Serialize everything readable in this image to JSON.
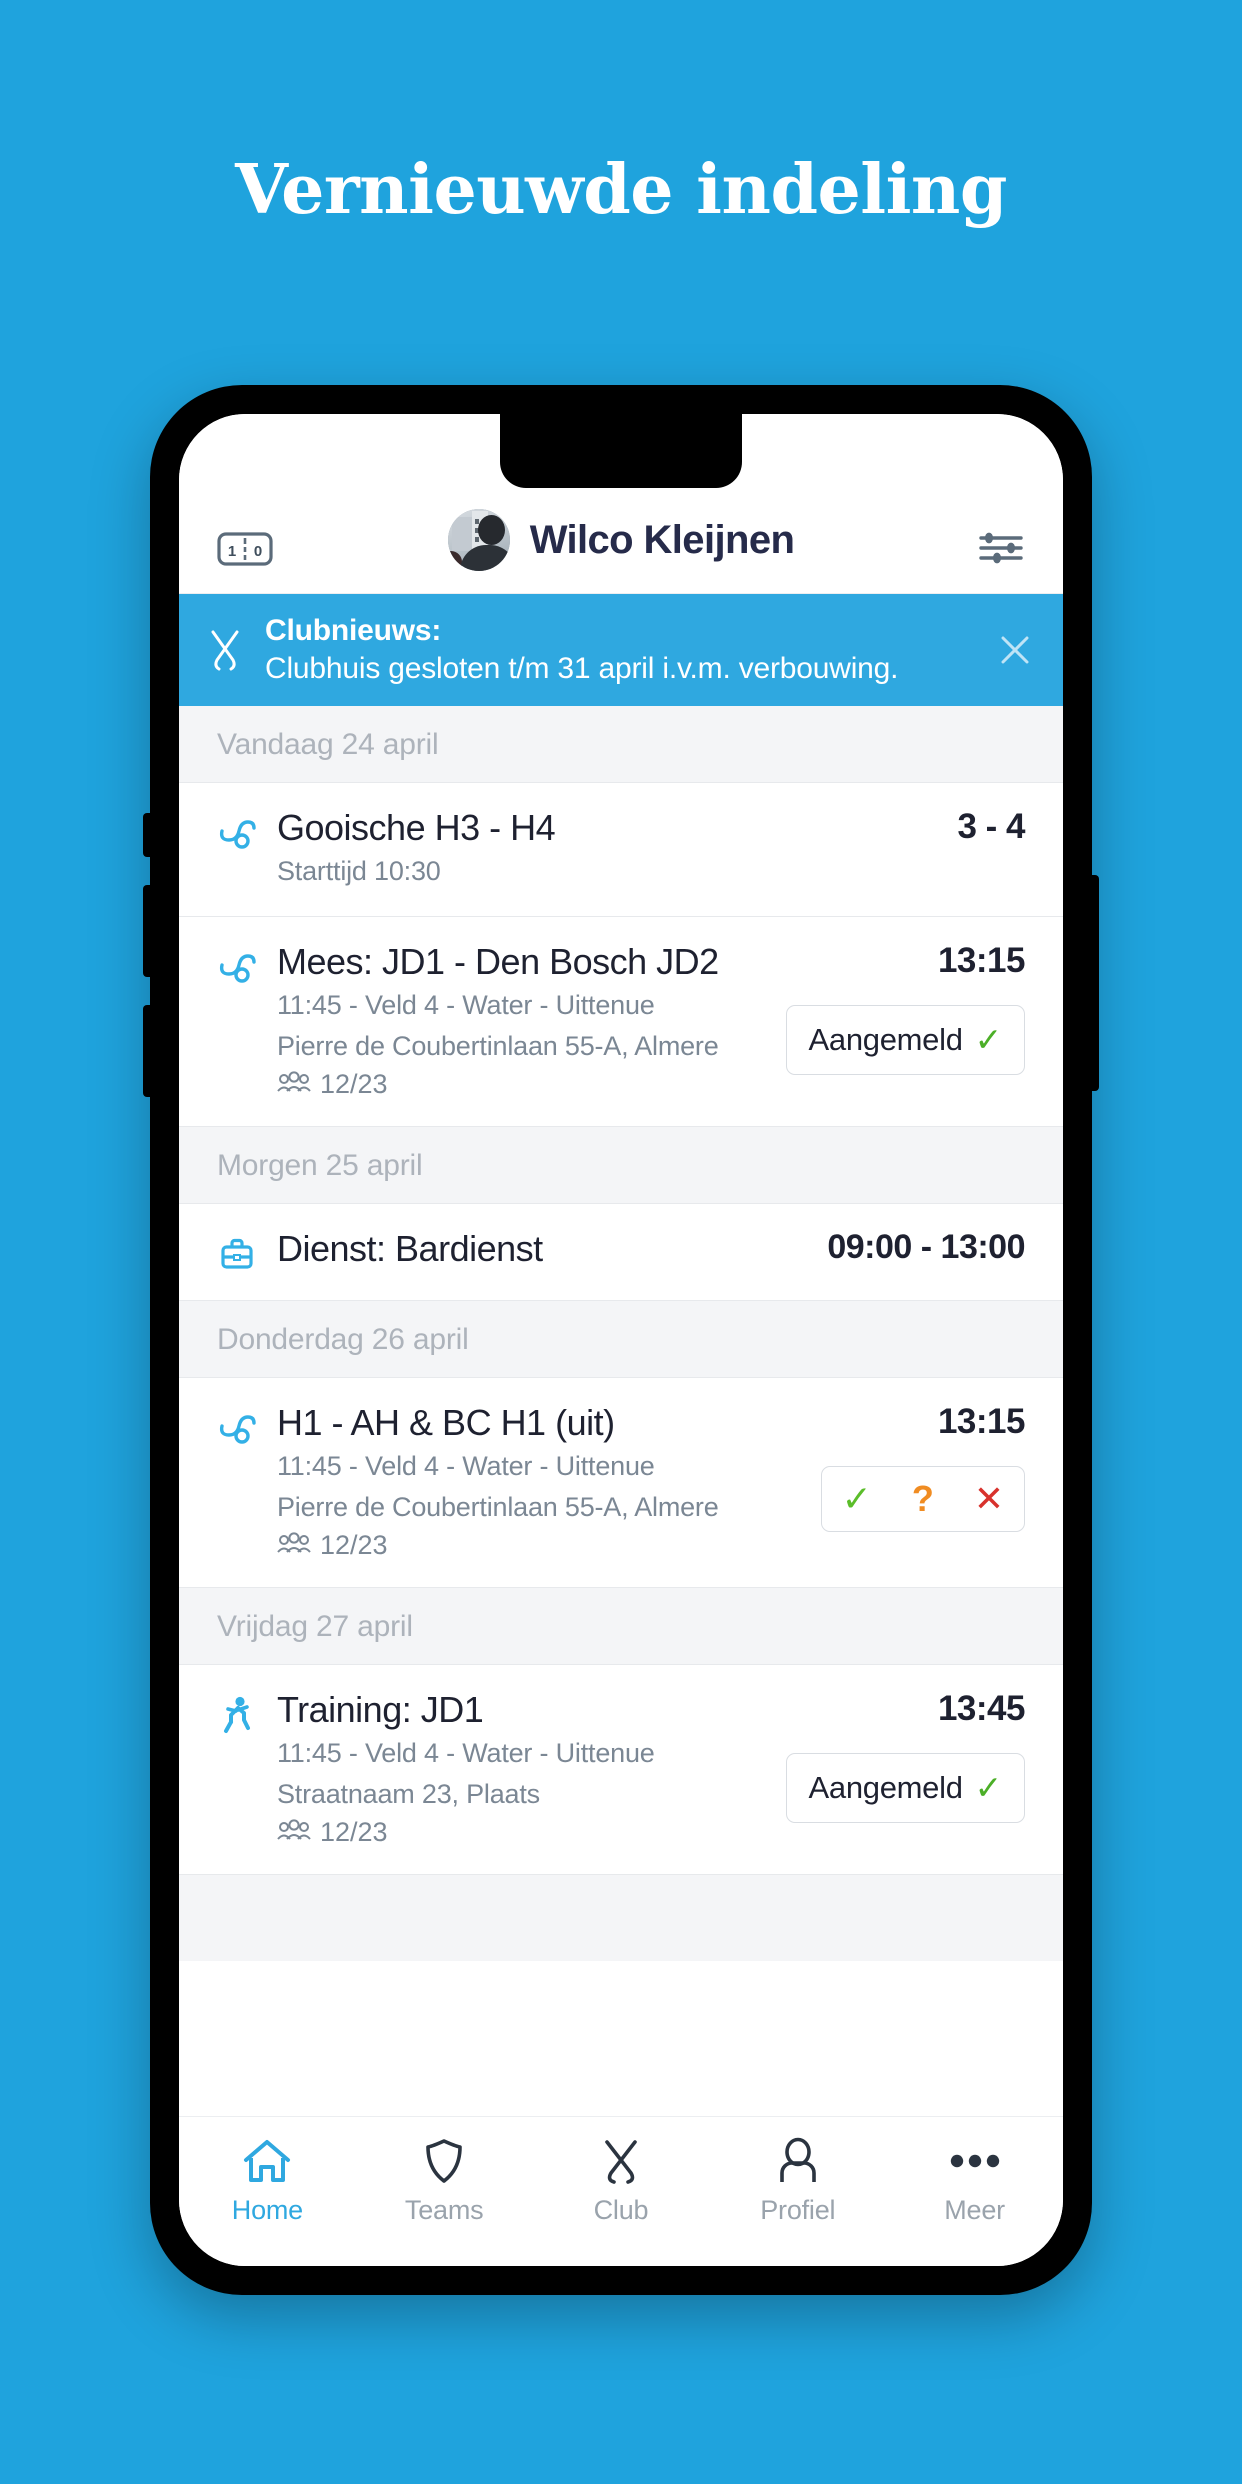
{
  "headline": "Vernieuwde indeling",
  "colors": {
    "background": "#1fa3dd",
    "accent": "#2fa8e0",
    "text_dark": "#1e2130",
    "text_muted": "#7b8794",
    "green": "#4caf28",
    "orange": "#f08c22",
    "red": "#d8322d"
  },
  "header": {
    "score_icon": "scoreboard-icon",
    "score_left": "1",
    "score_divider": ":",
    "score_right": "0",
    "avatar": "user-avatar",
    "user_name": "Wilco Kleijnen",
    "settings_icon": "sliders-icon"
  },
  "banner": {
    "icon": "crossed-hockey-sticks-icon",
    "title": "Clubnieuws:",
    "body": "Clubhuis gesloten t/m 31 april i.v.m. verbouwing.",
    "close_icon": "close-icon"
  },
  "sections": [
    {
      "day": "Vandaag 24 april",
      "items": [
        {
          "icon": "hockey-stick-ball-icon",
          "title": "Gooische H3 - H4",
          "sub1": "Starttijd 10:30",
          "sub2": "",
          "count": "",
          "time": "3 - 4",
          "action": "none"
        },
        {
          "icon": "hockey-stick-ball-icon",
          "title": "Mees: JD1 - Den Bosch JD2",
          "sub1": "11:45 - Veld 4 - Water - Uittenue",
          "sub2": "Pierre de Coubertinlaan 55-A, Almere",
          "count": "12/23",
          "time": "13:15",
          "action": "pill",
          "pill_label": "Aangemeld",
          "pill_check": "✓"
        }
      ]
    },
    {
      "day": "Morgen 25 april",
      "items": [
        {
          "icon": "briefcase-icon",
          "title": "Dienst: Bardienst",
          "sub1": "",
          "sub2": "",
          "count": "",
          "time": "09:00 - 13:00",
          "action": "none"
        }
      ]
    },
    {
      "day": "Donderdag 26 april",
      "items": [
        {
          "icon": "hockey-stick-ball-icon",
          "title": "H1 - AH & BC H1 (uit)",
          "sub1": "11:45 - Veld 4 - Water - Uittenue",
          "sub2": "Pierre de Coubertinlaan 55-A, Almere",
          "count": "12/23",
          "time": "13:15",
          "action": "rsvp",
          "rsvp_yes": "✓",
          "rsvp_maybe": "?",
          "rsvp_no": "✕"
        }
      ]
    },
    {
      "day": "Vrijdag 27 april",
      "items": [
        {
          "icon": "running-person-icon",
          "title": "Training: JD1",
          "sub1": "11:45 - Veld 4 - Water - Uittenue",
          "sub2": "Straatnaam 23, Plaats",
          "count": "12/23",
          "time": "13:45",
          "action": "pill",
          "pill_label": "Aangemeld",
          "pill_check": "✓"
        }
      ]
    }
  ],
  "tabbar": {
    "items": [
      {
        "icon": "home-icon",
        "label": "Home",
        "active": true
      },
      {
        "icon": "shield-icon",
        "label": "Teams",
        "active": false
      },
      {
        "icon": "crossed-hockey-sticks-icon",
        "label": "Club",
        "active": false
      },
      {
        "icon": "person-icon",
        "label": "Profiel",
        "active": false
      },
      {
        "icon": "ellipsis-icon",
        "label": "Meer",
        "active": false
      }
    ]
  }
}
